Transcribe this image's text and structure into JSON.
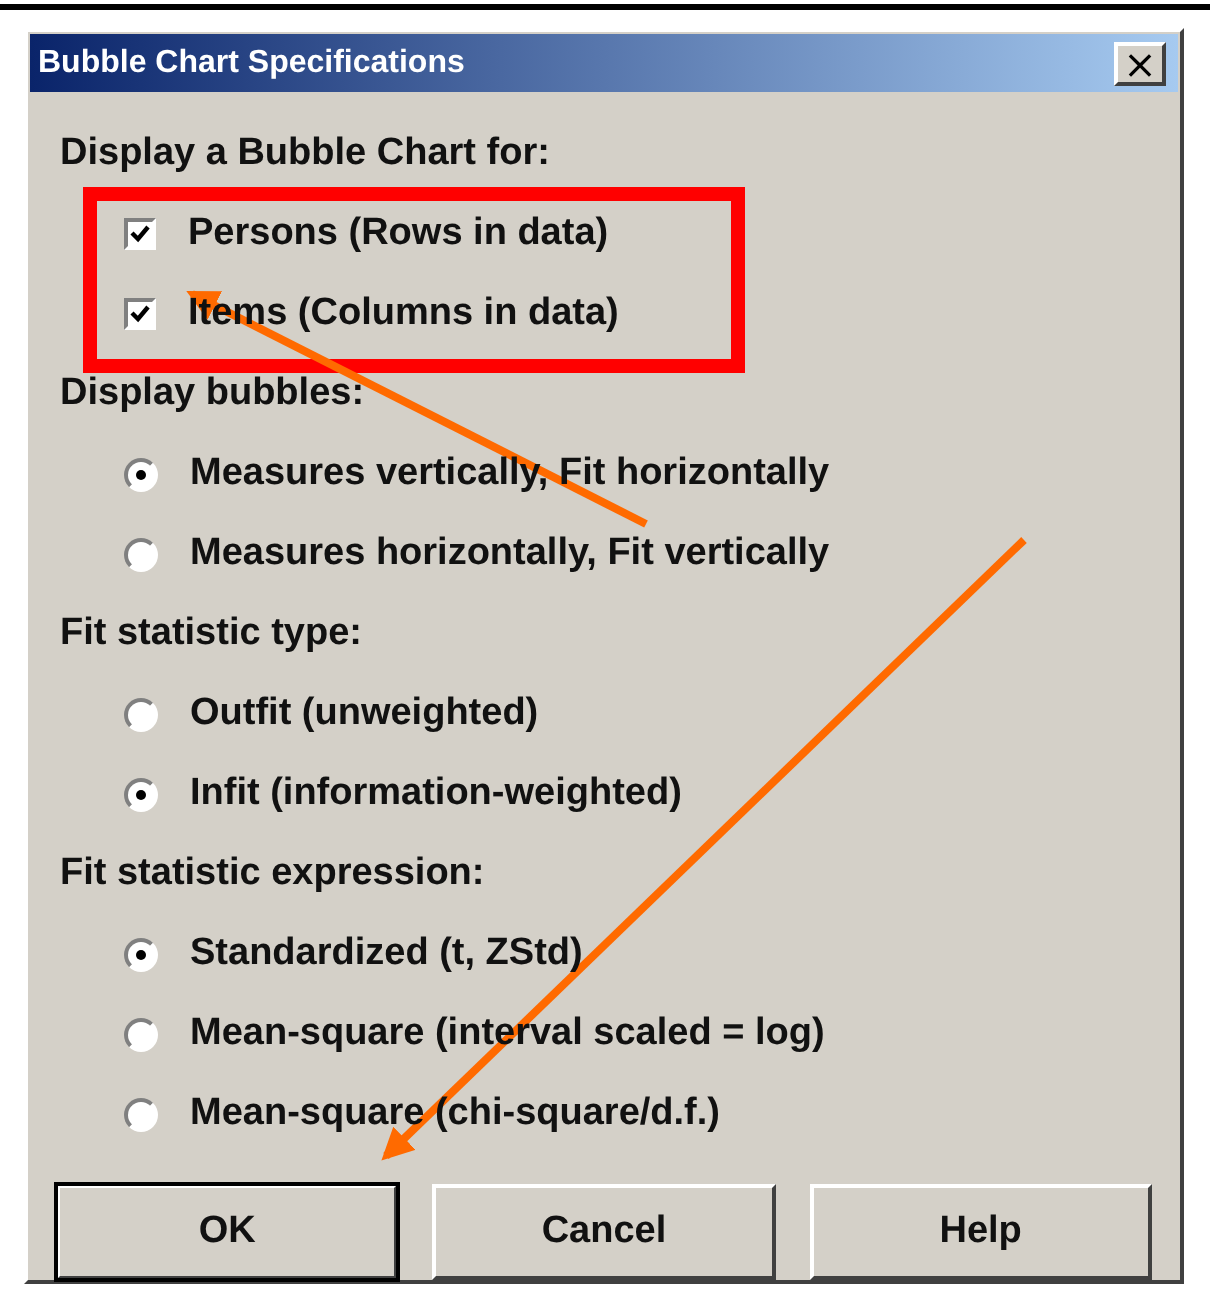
{
  "window": {
    "title": "Bubble Chart Specifications",
    "close": "×"
  },
  "groups": [
    {
      "label": "Display a Bubble Chart for:",
      "kind": "checkbox",
      "options": [
        {
          "label": "Persons (Rows in data)",
          "checked": true
        },
        {
          "label": "Items (Columns in data)",
          "checked": true
        }
      ]
    },
    {
      "label": "Display bubbles:",
      "kind": "radio",
      "options": [
        {
          "label": "Measures vertically, Fit horizontally",
          "selected": true
        },
        {
          "label": "Measures horizontally, Fit vertically",
          "selected": false
        }
      ]
    },
    {
      "label": "Fit statistic type:",
      "kind": "radio",
      "options": [
        {
          "label": "Outfit (unweighted)",
          "selected": false
        },
        {
          "label": "Infit (information-weighted)",
          "selected": true
        }
      ]
    },
    {
      "label": "Fit statistic expression:",
      "kind": "radio",
      "options": [
        {
          "label": "Standardized (t, ZStd)",
          "selected": true
        },
        {
          "label": "Mean-square (interval scaled = log)",
          "selected": false
        },
        {
          "label": "Mean-square (chi-square/d.f.)",
          "selected": false
        }
      ]
    }
  ],
  "buttons": [
    {
      "label": "OK",
      "default": true
    },
    {
      "label": "Cancel",
      "default": false
    },
    {
      "label": "Help",
      "default": false
    }
  ]
}
